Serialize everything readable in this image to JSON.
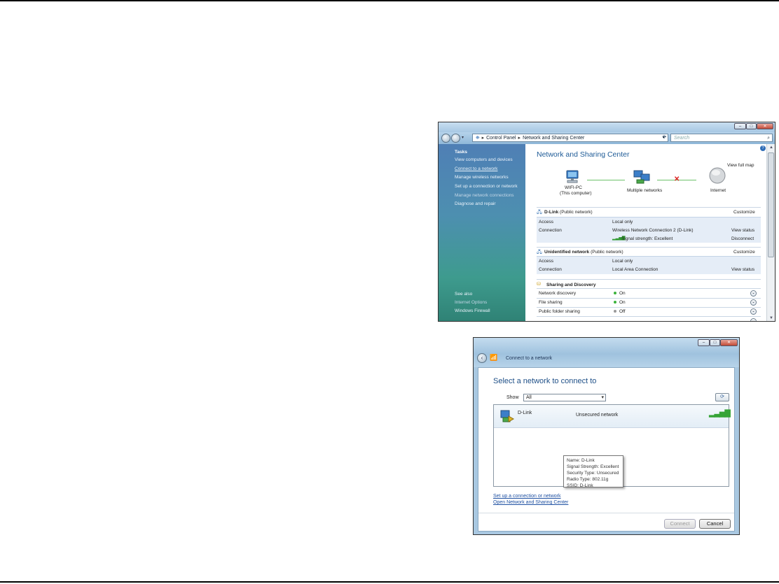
{
  "nsc": {
    "address": {
      "part1": "Control Panel",
      "part2": "Network and Sharing Center"
    },
    "search_placeholder": "Search",
    "sidebar": {
      "tasks_header": "Tasks",
      "items": [
        "View computers and devices",
        "Connect to a network",
        "Manage wireless networks",
        "Set up a connection or network",
        "Manage network connections",
        "Diagnose and repair"
      ],
      "see_also": "See also",
      "see_also_items": [
        "Internet Options",
        "Windows Firewall"
      ]
    },
    "title": "Network and Sharing Center",
    "view_full_map": "View full map",
    "map": {
      "computer_label": "WIFI-PC",
      "computer_sub": "(This computer)",
      "middle_label": "Multiple networks",
      "internet_label": "Internet"
    },
    "network1": {
      "name": "D-Link",
      "type": "(Public network)",
      "customize": "Customize",
      "access_label": "Access",
      "access_value": "Local only",
      "connection_label": "Connection",
      "connection_value": "Wireless Network Connection 2 (D-Link)",
      "view_status": "View status",
      "signal": "Signal strength:  Excellent",
      "disconnect": "Disconnect"
    },
    "network2": {
      "name": "Unidentified network",
      "type": "(Public network)",
      "customize": "Customize",
      "access_label": "Access",
      "access_value": "Local only",
      "connection_label": "Connection",
      "connection_value": "Local Area Connection",
      "view_status": "View status"
    },
    "sharing": {
      "header": "Sharing and Discovery",
      "rows": [
        {
          "label": "Network discovery",
          "value": "On"
        },
        {
          "label": "File sharing",
          "value": "On"
        },
        {
          "label": "Public folder sharing",
          "value": "Off"
        }
      ]
    },
    "colors": {
      "on": "#3bb33b",
      "off": "#9a9a9a",
      "accent": "#1f5fa9"
    }
  },
  "connect": {
    "title": "Connect to a network",
    "heading": "Select a network to connect to",
    "show_label": "Show",
    "show_value": "All",
    "network": {
      "name": "D-Link",
      "security": "Unsecured network"
    },
    "tooltip": [
      "Name: D-Link",
      "Signal Strength: Excellent",
      "Security Type: Unsecured",
      "Radio Type: 802.11g",
      "SSID: D-Link"
    ],
    "link1": "Set up a connection or network",
    "link2": "Open Network and Sharing Center",
    "connect_button": "Connect",
    "cancel_button": "Cancel"
  }
}
